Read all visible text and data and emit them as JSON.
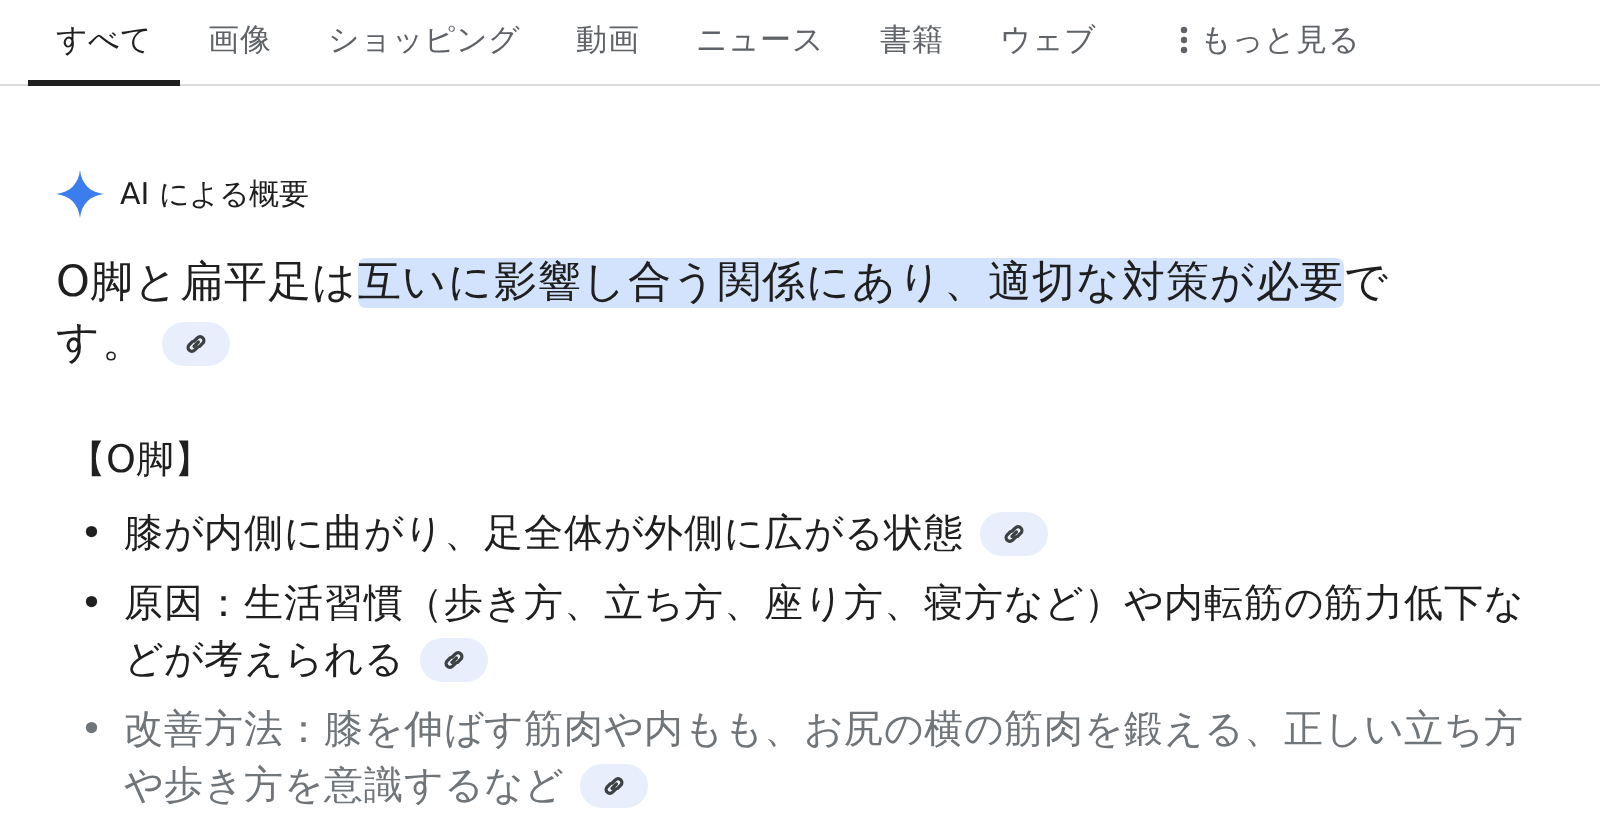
{
  "tabs": [
    {
      "label": "すべて",
      "selected": true
    },
    {
      "label": "画像",
      "selected": false
    },
    {
      "label": "ショッピング",
      "selected": false
    },
    {
      "label": "動画",
      "selected": false
    },
    {
      "label": "ニュース",
      "selected": false
    },
    {
      "label": "書籍",
      "selected": false
    },
    {
      "label": "ウェブ",
      "selected": false
    },
    {
      "label": "もっと見る",
      "selected": false,
      "kind": "more"
    }
  ],
  "overview": {
    "title": "AI による概要",
    "summary_lines": [
      {
        "parts": [
          {
            "text": "O脚と扁平足は",
            "highlighted": false
          },
          {
            "text": "互いに影響し合う関係にあり、適切な対策が必要",
            "highlighted": true
          },
          {
            "text": "で",
            "highlighted": false
          }
        ]
      },
      {
        "parts": [
          {
            "text": "す。",
            "highlighted": false
          }
        ]
      }
    ],
    "section_heading": "【O脚】",
    "bullets": [
      {
        "marker": "•",
        "lines": [
          "膝が内側に曲がり、足全体が外側に広がる状態"
        ],
        "faded": false
      },
      {
        "marker": "•",
        "lines": [
          "原因：生活習慣（歩き方、立ち方、座り方、寝方など）や内転筋の筋力低下な",
          "どが考えられる"
        ],
        "faded": false
      },
      {
        "marker": "•",
        "lines": [
          "改善方法：膝を伸ばす筋肉や内もも、お尻の横の筋肉を鍛える、正しい立ち方",
          "や歩き方を意識するなど"
        ],
        "faded": true
      }
    ]
  }
}
